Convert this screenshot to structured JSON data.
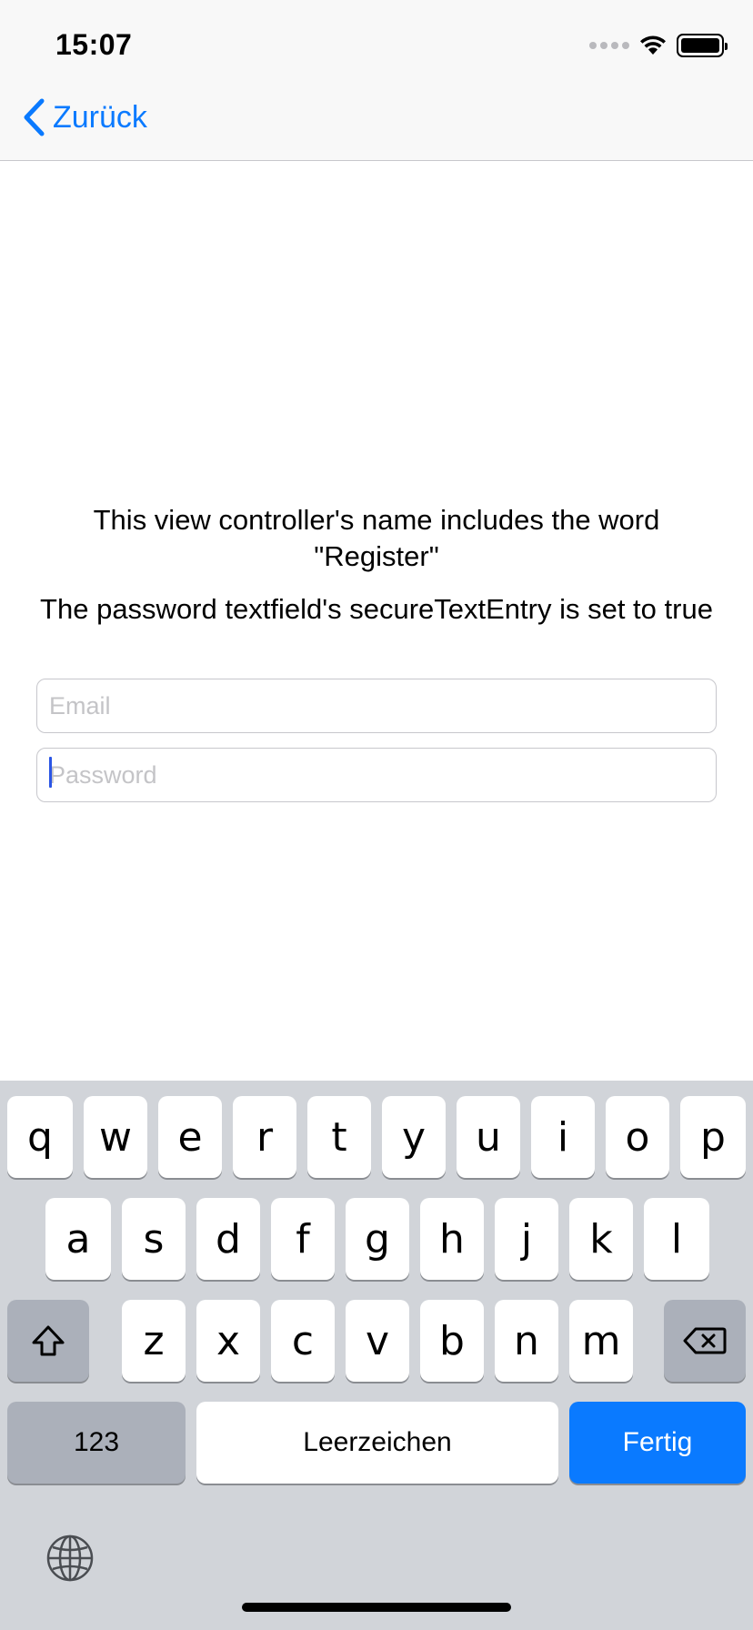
{
  "status_bar": {
    "time": "15:07"
  },
  "nav": {
    "back_label": "Zurück"
  },
  "content": {
    "label_register": "This view controller's name includes the word \"Register\"",
    "label_password": "The password textfield's secureTextEntry is set to true",
    "email_placeholder": "Email",
    "password_placeholder": "Password"
  },
  "keyboard": {
    "row1": [
      "q",
      "w",
      "e",
      "r",
      "t",
      "y",
      "u",
      "i",
      "o",
      "p"
    ],
    "row2": [
      "a",
      "s",
      "d",
      "f",
      "g",
      "h",
      "j",
      "k",
      "l"
    ],
    "row3": [
      "z",
      "x",
      "c",
      "v",
      "b",
      "n",
      "m"
    ],
    "numbers_label": "123",
    "space_label": "Leerzeichen",
    "done_label": "Fertig",
    "icons": {
      "shift": "shift-icon",
      "delete": "delete-icon",
      "globe": "globe-icon"
    },
    "accent_color": "#0a7aff"
  }
}
